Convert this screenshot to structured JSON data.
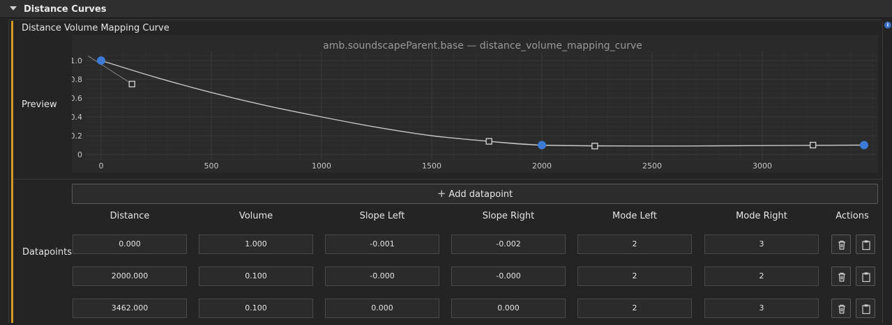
{
  "section": {
    "title": "Distance Curves"
  },
  "property": {
    "label": "Distance Volume Mapping Curve"
  },
  "info_icon": "info-icon",
  "preview": {
    "label": "Preview",
    "chart_data": {
      "type": "line",
      "title": "amb.soundscapeParent.base — distance_volume_mapping_curve",
      "xlabel": "",
      "ylabel": "",
      "xlim": [
        -80,
        3500
      ],
      "ylim": [
        -0.05,
        1.05
      ],
      "x_ticks": [
        "0",
        "500",
        "1000",
        "1500",
        "2000",
        "2500",
        "3000"
      ],
      "y_ticks": [
        "0",
        "0.2",
        "0.4",
        "0.6",
        "0.8",
        "1.0"
      ],
      "grid": true,
      "series": [
        {
          "points": [
            [
              0,
              1.0
            ],
            [
              2000,
              0.1
            ],
            [
              3462,
              0.1
            ]
          ],
          "tangent_handles": [
            [
              140,
              0.75
            ],
            [
              1760,
              0.14
            ],
            [
              2240,
              0.09
            ],
            [
              3230,
              0.1
            ]
          ],
          "curve": [
            [
              0,
              1.0
            ],
            [
              250,
              0.82
            ],
            [
              500,
              0.66
            ],
            [
              750,
              0.52
            ],
            [
              1000,
              0.4
            ],
            [
              1250,
              0.29
            ],
            [
              1500,
              0.2
            ],
            [
              1760,
              0.14
            ],
            [
              2000,
              0.1
            ],
            [
              2500,
              0.09
            ],
            [
              3000,
              0.095
            ],
            [
              3462,
              0.1
            ]
          ]
        }
      ]
    }
  },
  "datapoints": {
    "label": "Datapoints",
    "add_label": "Add datapoint",
    "columns": [
      "Distance",
      "Volume",
      "Slope Left",
      "Slope Right",
      "Mode Left",
      "Mode Right",
      "Actions"
    ],
    "rows": [
      {
        "distance": "0.000",
        "volume": "1.000",
        "slope_left": "-0.001",
        "slope_right": "-0.002",
        "mode_left": "2",
        "mode_right": "3"
      },
      {
        "distance": "2000.000",
        "volume": "0.100",
        "slope_left": "-0.000",
        "slope_right": "-0.000",
        "mode_left": "2",
        "mode_right": "2"
      },
      {
        "distance": "3462.000",
        "volume": "0.100",
        "slope_left": "0.000",
        "slope_right": "0.000",
        "mode_left": "2",
        "mode_right": "3"
      }
    ],
    "delete_icon": "trash-icon",
    "paste_icon": "clipboard-icon"
  },
  "colors": {
    "accent": "#d39a23",
    "point": "#3b7bd6",
    "curve": "#c8c8c8"
  }
}
